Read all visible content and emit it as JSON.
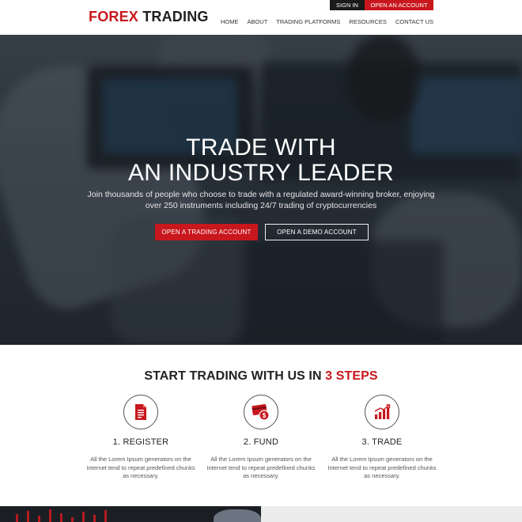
{
  "header": {
    "logo_part1": "FOREX",
    "logo_part2": "TRADING",
    "signin_label": "SIGN IN",
    "open_account_label": "OPEN AN ACCOUNT",
    "nav": [
      "HOME",
      "ABOUT",
      "TRADING PLATFORMS",
      "RESOURCES",
      "CONTACT US"
    ]
  },
  "hero": {
    "title_line1": "TRADE WITH",
    "title_line2": "AN INDUSTRY LEADER",
    "subtitle": "Join thousands of people who choose to trade with a regulated award-winning broker, enjoying over 250 instruments including 24/7 trading of cryptocurrencies",
    "primary_button": "OPEN A TRADING ACCOUNT",
    "secondary_button": "OPEN A DEMO ACCOUNT"
  },
  "steps": {
    "heading_prefix": "START TRADING WITH US IN ",
    "heading_accent": "3 STEPS",
    "items": [
      {
        "title": "1. REGISTER",
        "description": "All the Lorem Ipsum generators on the Internet tend to repeat predefined chunks as necessary.",
        "icon": "document-icon"
      },
      {
        "title": "2. FUND",
        "description": "All the Lorem Ipsum generators on the Internet tend to repeat predefined chunks as necessary.",
        "icon": "card-dollar-icon"
      },
      {
        "title": "3. TRADE",
        "description": "All the Lorem Ipsum generators on the Internet tend to repeat predefined chunks as necessary.",
        "icon": "growth-chart-icon"
      }
    ]
  },
  "colors": {
    "accent": "#c8171d",
    "dark": "#1a1a1a"
  }
}
